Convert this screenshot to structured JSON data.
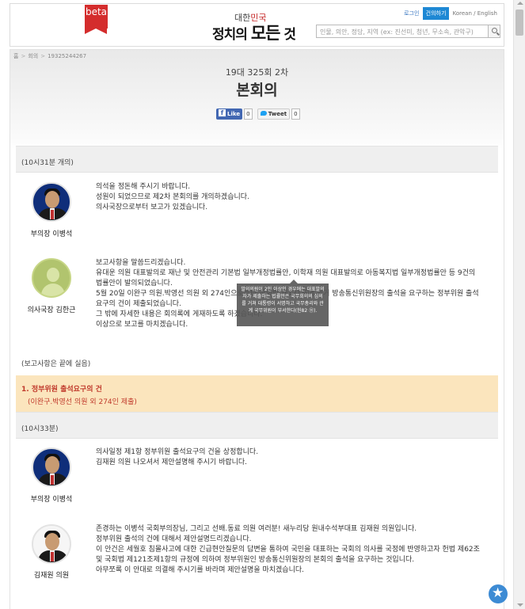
{
  "header": {
    "beta_label": "beta",
    "logo_line1_a": "대한",
    "logo_line1_b": "민국",
    "logo_line2_a": "정치의 ",
    "logo_line2_b": "모든",
    "logo_line2_c": " 것",
    "login_label": "로그인",
    "suggest_label": "건의하기",
    "lang_label": "Korean / English",
    "search_placeholder": "인물, 의안, 정당, 지역 (ex: 진선미, 청년, 무소속, 관악구)"
  },
  "breadcrumb": [
    "홈",
    "회의",
    "19325244267"
  ],
  "meeting": {
    "session": "19대 325회 2차",
    "title": "본회의"
  },
  "share": {
    "like_label": "Like",
    "like_count": "0",
    "tweet_label": "Tweet",
    "tweet_count": "0"
  },
  "time1": "(10시31분 개의)",
  "speeches1": [
    {
      "speaker": "부의장 이병석",
      "lines": [
        "의석을 정돈해 주시기 바랍니다.",
        "성원이 되었으므로 제2차 본회의를 개의하겠습니다.",
        "의사국장으로부터 보고가 있겠습니다."
      ]
    },
    {
      "speaker": "의사국장 김한근",
      "lines": [
        "보고사항을 말씀드리겠습니다.",
        "유대운 의원 대표발의로 재난 및 안전관리 기본법 일부개정법률안, 이학재 의원 대표발의로 아동복지법 일부개정법률안 등 9건의 법률안이 발의되었습니다.",
        "5월 20일 이완구 의원.박영선 의원 외 274인으로부터 국회법 제121조에 의거 방송통신위원장의 출석을 요구하는 정부위원 출석요구의 건이 제출되었습니다.",
        "그 밖에 자세한 내용은 회의록에 게재하도록 하겠습니다.",
        "이상으로 보고를 마치겠습니다."
      ]
    }
  ],
  "tooltip_text": "발의의원이 2인 이상인 경우에는 대표발의자가 제출하는 법률안은 국무회의의 심의를 거쳐 대통령이 서명하고 국무총리와 관계 국무위원이 부서한다(헌82 ⑪).",
  "note": "(보고사항은 끝에 실음)",
  "agenda": {
    "title": "1. 정부위원 출석요구의 건",
    "subtitle": "(이완구.박영선 의원 외 274인 제출)"
  },
  "time2": "(10시33분)",
  "speeches2": [
    {
      "speaker": "부의장 이병석",
      "lines": [
        "의사일정 제1항 정부위원 출석요구의 건을 상정합니다.",
        "김재원 의원 나오셔서 제안설명해 주시기 바랍니다."
      ]
    },
    {
      "speaker": "김재원 의원",
      "lines": [
        "존경하는 이병석 국회부의장님, 그리고 선배.동료 의원 여러분! 새누리당 원내수석부대표 김재원 의원입니다.",
        "정부위원 출석의 건에 대해서 제안설명드리겠습니다.",
        "이 안건은 세월호 침몰사고에 대한 긴급현안질문의 답변을 통하여 국민을 대표하는 국회의 의사를 국정에 반영하고자 헌법 제62조 및 국회법 제121조제1항의 규정에 의하여 정부위원인 방송통신위원장의 본회의 출석을 요구하는 것입니다.",
        "아무쪼록 이 안대로 의결해 주시기를 바라며 제안설명을 마치겠습니다."
      ]
    }
  ],
  "icons": {
    "search": "search-icon",
    "like": "facebook-icon",
    "tweet": "twitter-icon",
    "fab": "star-icon"
  },
  "colors": {
    "accent": "#1e88d4",
    "beta": "#d42d2d",
    "agenda_bg": "#fbe5bd",
    "agenda_text": "#c0392b"
  }
}
